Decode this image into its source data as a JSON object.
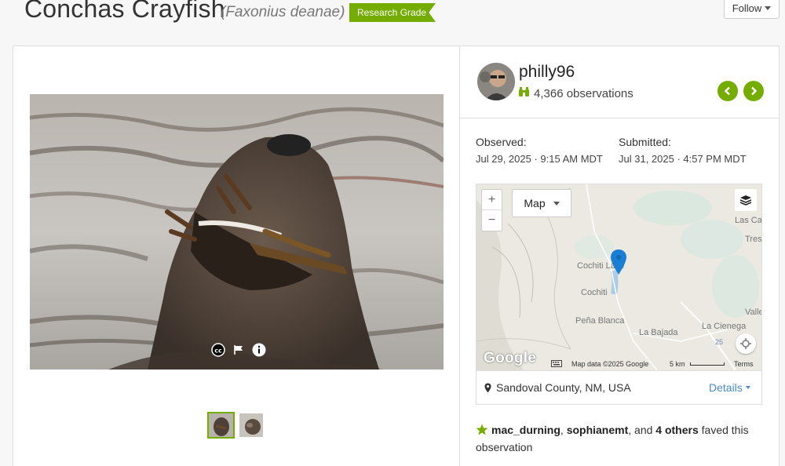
{
  "title": {
    "common_name": "Conchas Crayfish",
    "scientific_name": "(Faxonius deanae)",
    "quality_grade": "Research Grade"
  },
  "follow_button": {
    "label": "Follow"
  },
  "observer": {
    "username": "philly96",
    "observation_count": "4,366 observations"
  },
  "observed": {
    "label": "Observed:",
    "value": "Jul 29, 2025 · 9:15 AM MDT"
  },
  "submitted": {
    "label": "Submitted:",
    "value": "Jul 31, 2025 · 4:57 PM MDT"
  },
  "map": {
    "type_select": "Map",
    "zoom_in": "+",
    "zoom_out": "−",
    "attribution": "Map data ©2025 Google",
    "scale": "5 km",
    "terms": "Terms",
    "logo": "Google",
    "places": {
      "cochiti_lake": "Cochiti Lake",
      "cochiti": "Cochiti",
      "pena_blanca": "Peña Blanca",
      "la_bajada": "La Bajada",
      "la_cienega": "La Cienega",
      "las_ca": "Las Ca",
      "tres": "Tres",
      "valle": "Valle",
      "hw25": "25"
    }
  },
  "location": {
    "text": "Sandoval County, NM, USA",
    "details_label": "Details"
  },
  "faves": {
    "user1": "mac_durning",
    "sep1": ", ",
    "user2": "sophianemt",
    "sep2": ", and ",
    "others": "4 others",
    "suffix": " faved this observation"
  },
  "colors": {
    "accent": "#74ac00",
    "link": "#4a8cc4",
    "pin": "#1a7fd4"
  },
  "icons": [
    "binoculars-icon",
    "chevron-left-icon",
    "chevron-right-icon",
    "layers-icon",
    "map-pin-icon",
    "locate-icon",
    "star-icon",
    "cc-icon",
    "flag-icon",
    "info-icon",
    "keyboard-icon",
    "caret-down-icon"
  ]
}
